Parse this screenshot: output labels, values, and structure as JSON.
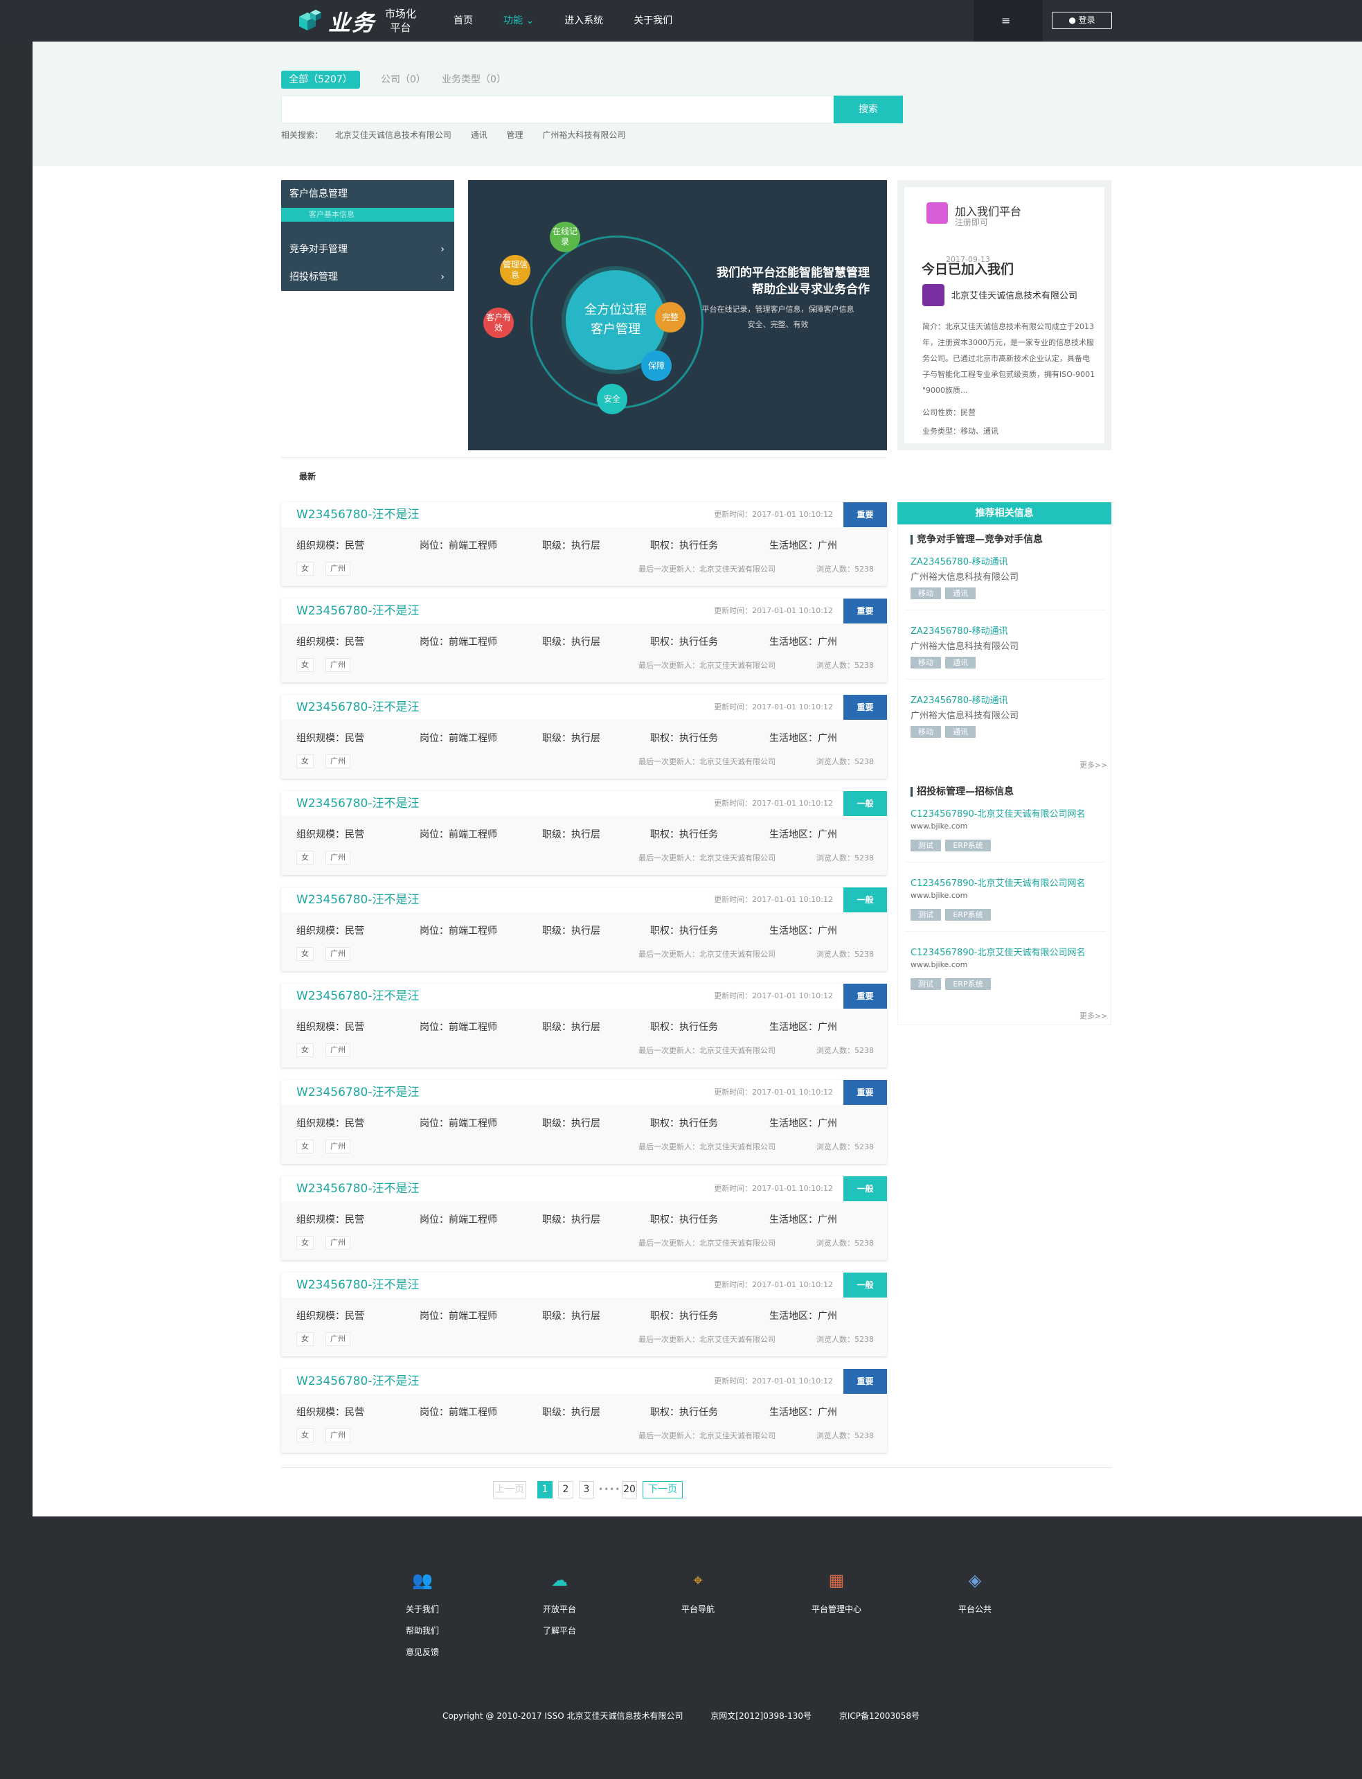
{
  "header": {
    "logo_text": "业务",
    "logo_sub1": "市场化",
    "logo_sub2": "平台",
    "nav": [
      "首页",
      "功能",
      "进入系统",
      "关于我们"
    ],
    "active_nav_suffix": "⌄",
    "menu_icon": "≡",
    "login_label": "登录",
    "login_icon": "user-icon"
  },
  "filter": {
    "tab_all": "全部（5207）",
    "tab_company": "公司（0）",
    "tab_type": "业务类型（0）",
    "search_placeholder": "",
    "search_button": "搜索",
    "related_label": "相关搜索：",
    "related": [
      "北京艾佳天诚信息技术有限公司",
      "通讯",
      "管理",
      "广州裕大科技有限公司"
    ]
  },
  "left_menu": {
    "items": [
      "客户信息管理",
      "竞争对手管理",
      "招投标管理"
    ],
    "sub_item": "客户基本信息",
    "chevron": "›"
  },
  "banner": {
    "core_line1": "全方位过程",
    "core_line2": "客户管理",
    "bubbles": [
      "在线记录",
      "管理信息",
      "客户有效",
      "完整",
      "保障",
      "安全"
    ],
    "title_line1": "我们的平台还能智能智慧管理",
    "title_line2": "帮助企业寻求业务合作",
    "desc_line1": "平台在线记录，管理客户信息，保障客户信息",
    "desc_line2": "安全、完整、有效"
  },
  "join_panel": {
    "title": "加入我们平台",
    "subtitle": "注册即可",
    "date": "2017-09-13",
    "today": "今日已加入我们",
    "company": "北京艾佳天诚信息技术有限公司",
    "desc": "简介：北京艾佳天诚信息技术有限公司成立于2013年，注册资本3000万元，是一家专业的信息技术服务公司。已通过北京市高新技术企业认定，具备电子与智能化工程专业承包贰级资质，拥有ISO-9001 \"9000族质...",
    "nature": "公司性质：民营",
    "business": "业务类型：移动、通讯"
  },
  "section": {
    "title": "最新"
  },
  "cards": [
    {
      "title": "W23456780-汪不是汪",
      "time": "更新时间：2017-01-01 10:10:12",
      "badge": "重要",
      "badge_color": "#296bb2"
    },
    {
      "title": "W23456780-汪不是汪",
      "time": "更新时间：2017-01-01 10:10:12",
      "badge": "重要",
      "badge_color": "#296bb2"
    },
    {
      "title": "W23456780-汪不是汪",
      "time": "更新时间：2017-01-01 10:10:12",
      "badge": "重要",
      "badge_color": "#296bb2"
    },
    {
      "title": "W23456780-汪不是汪",
      "time": "更新时间：2017-01-01 10:10:12",
      "badge": "一般",
      "badge_color": "#20c3bb"
    },
    {
      "title": "W23456780-汪不是汪",
      "time": "更新时间：2017-01-01 10:10:12",
      "badge": "一般",
      "badge_color": "#20c3bb"
    },
    {
      "title": "W23456780-汪不是汪",
      "time": "更新时间：2017-01-01 10:10:12",
      "badge": "重要",
      "badge_color": "#296bb2"
    },
    {
      "title": "W23456780-汪不是汪",
      "time": "更新时间：2017-01-01 10:10:12",
      "badge": "重要",
      "badge_color": "#296bb2"
    },
    {
      "title": "W23456780-汪不是汪",
      "time": "更新时间：2017-01-01 10:10:12",
      "badge": "一般",
      "badge_color": "#20c3bb"
    },
    {
      "title": "W23456780-汪不是汪",
      "time": "更新时间：2017-01-01 10:10:12",
      "badge": "一般",
      "badge_color": "#20c3bb"
    },
    {
      "title": "W23456780-汪不是汪",
      "time": "更新时间：2017-01-01 10:10:12",
      "badge": "重要",
      "badge_color": "#296bb2"
    }
  ],
  "card_common": {
    "scale": "组织规模：民营",
    "post": "岗位：前端工程师",
    "level": "职级：执行层",
    "duty": "职权：执行任务",
    "area": "生活地区：广州",
    "tag1": "女",
    "tag2": "广州",
    "updater": "最后一次更新人：北京艾佳天诚有限公司",
    "views": "浏览人数：5238"
  },
  "sidebar": {
    "head": "推荐相关信息",
    "sec1": "竞争对手管理—竞争对手信息",
    "competitors": [
      {
        "title": "ZA23456780-移动通讯",
        "sub": "广州裕大信息科技有限公司",
        "tags": [
          "移动",
          "通讯"
        ]
      },
      {
        "title": "ZA23456780-移动通讯",
        "sub": "广州裕大信息科技有限公司",
        "tags": [
          "移动",
          "通讯"
        ]
      },
      {
        "title": "ZA23456780-移动通讯",
        "sub": "广州裕大信息科技有限公司",
        "tags": [
          "移动",
          "通讯"
        ]
      }
    ],
    "more": "更多>>",
    "sec2": "招投标管理—招标信息",
    "bids": [
      {
        "title": "C1234567890-北京艾佳天诚有限公司网名",
        "sub": "www.bjike.com",
        "tags": [
          "测试",
          "ERP系统"
        ]
      },
      {
        "title": "C1234567890-北京艾佳天诚有限公司网名",
        "sub": "www.bjike.com",
        "tags": [
          "测试",
          "ERP系统"
        ]
      },
      {
        "title": "C1234567890-北京艾佳天诚有限公司网名",
        "sub": "www.bjike.com",
        "tags": [
          "测试",
          "ERP系统"
        ]
      }
    ]
  },
  "pager": {
    "prev": "上一页",
    "pages": [
      "1",
      "2",
      "3"
    ],
    "dots": "••••",
    "last": "20",
    "next": "下一页"
  },
  "footer": {
    "cols": [
      {
        "icon": "users-icon",
        "glyph": "👥",
        "links": [
          "关于我们",
          "帮助我们",
          "意见反馈"
        ]
      },
      {
        "icon": "cloud-icon",
        "glyph": "☁",
        "links": [
          "开放平台",
          "了解平台"
        ]
      },
      {
        "icon": "map-pin-icon",
        "glyph": "⌖",
        "links": [
          "平台导航"
        ]
      },
      {
        "icon": "grid-icon",
        "glyph": "▦",
        "links": [
          "平台管理中心"
        ]
      },
      {
        "icon": "layers-icon",
        "glyph": "◈",
        "links": [
          "平台公共"
        ]
      }
    ],
    "copyright": "Copyright @ 2010-2017 ISSO 北京艾佳天诚信息技术有限公司",
    "license1": "京网文[2012]0398-130号",
    "license2": "京ICP备12003058号"
  },
  "colors": {
    "accent": "#20c3bb",
    "dark_accent": "#1ba7a0",
    "blue_badge": "#296bb2",
    "menu_bg": "#304959",
    "filter_bg": "#f0f6f4"
  }
}
